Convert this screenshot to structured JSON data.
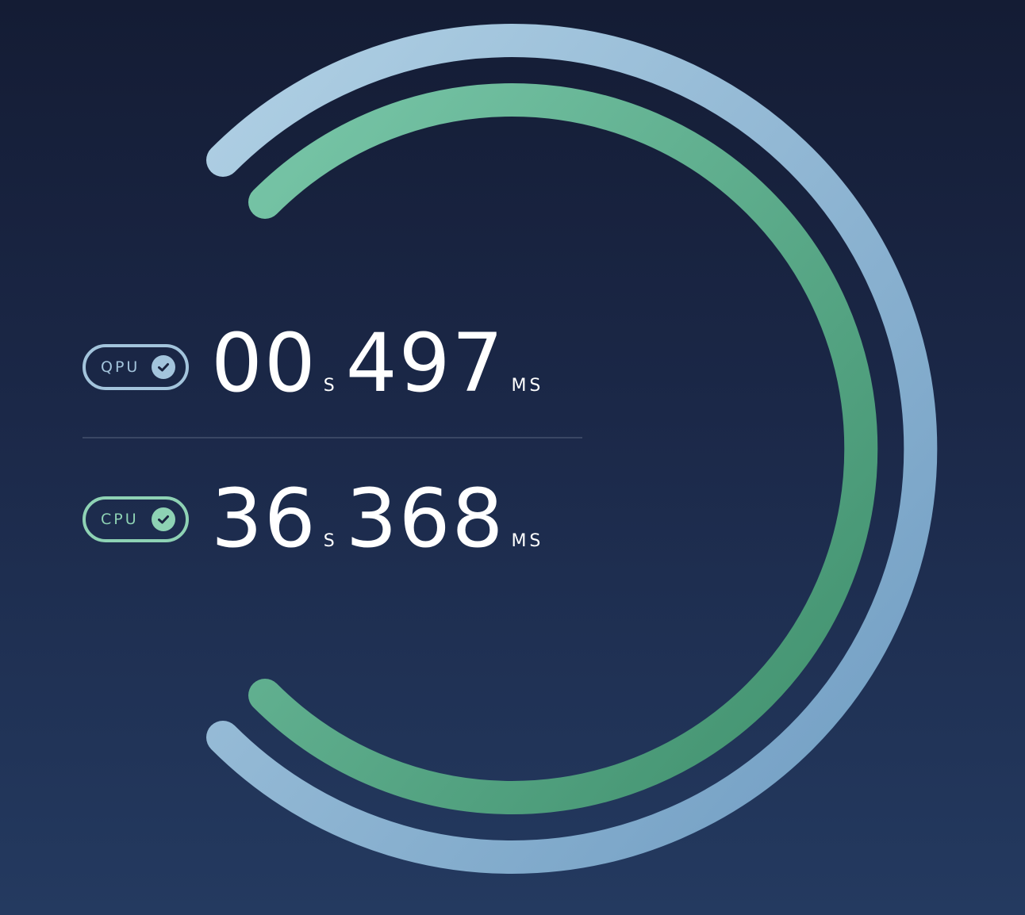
{
  "timers": [
    {
      "id": "qpu",
      "badge": "QPU",
      "seconds": "00",
      "seconds_unit": "S",
      "millis": "497",
      "millis_unit": "MS"
    },
    {
      "id": "cpu",
      "badge": "CPU",
      "seconds": "36",
      "seconds_unit": "S",
      "millis": "368",
      "millis_unit": "MS"
    }
  ],
  "colors": {
    "qpu": "#a3c4dc",
    "cpu": "#5bb591",
    "background_top": "#141c34",
    "background_bottom": "#243a60"
  },
  "icons": {
    "badge_status": "check-circle-icon"
  }
}
